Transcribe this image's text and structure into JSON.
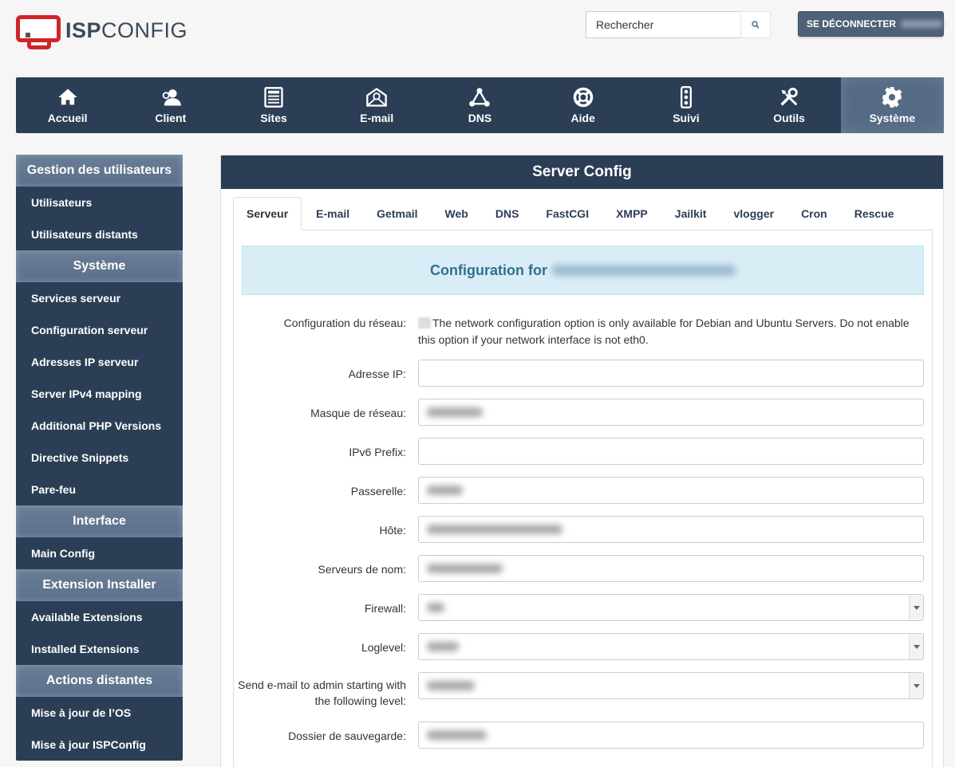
{
  "brand": {
    "logo_bold": "ISP",
    "logo_rest": "CONFIG",
    "accent": "#d2232a"
  },
  "search": {
    "placeholder": "Rechercher",
    "icon": "search-icon"
  },
  "logout": {
    "label": "SE DÉCONNECTER"
  },
  "topnav": [
    {
      "label": "Accueil",
      "icon": "home-icon"
    },
    {
      "label": "Client",
      "icon": "users-icon"
    },
    {
      "label": "Sites",
      "icon": "sites-icon"
    },
    {
      "label": "E-mail",
      "icon": "mail-icon"
    },
    {
      "label": "DNS",
      "icon": "dns-icon"
    },
    {
      "label": "Aide",
      "icon": "lifebuoy-icon"
    },
    {
      "label": "Suivi",
      "icon": "traffic-light-icon"
    },
    {
      "label": "Outils",
      "icon": "tools-icon"
    },
    {
      "label": "Système",
      "icon": "gear-icon",
      "active": true
    }
  ],
  "sidebar": {
    "sections": [
      {
        "heading": "Gestion des utilisateurs",
        "items": [
          "Utilisateurs",
          "Utilisateurs distants"
        ]
      },
      {
        "heading": "Système",
        "items": [
          "Services serveur",
          "Configuration serveur",
          "Adresses IP serveur",
          "Server IPv4 mapping",
          "Additional PHP Versions",
          "Directive Snippets",
          "Pare-feu"
        ]
      },
      {
        "heading": "Interface",
        "items": [
          "Main Config"
        ]
      },
      {
        "heading": "Extension Installer",
        "items": [
          "Available Extensions",
          "Installed Extensions"
        ]
      },
      {
        "heading": "Actions distantes",
        "items": [
          "Mise à jour de l’OS",
          "Mise à jour ISPConfig"
        ]
      }
    ]
  },
  "panel": {
    "title": "Server Config",
    "tabs": [
      "Serveur",
      "E-mail",
      "Getmail",
      "Web",
      "DNS",
      "FastCGI",
      "XMPP",
      "Jailkit",
      "vlogger",
      "Cron",
      "Rescue"
    ],
    "active_tab": "Serveur",
    "banner": "Configuration for",
    "network_label": "Configuration du réseau:",
    "network_text": "The network configuration option is only available for Debian and Ubuntu Servers. Do not enable this option if your network interface is not eth0.",
    "fields": [
      {
        "label": "Adresse IP:",
        "type": "text",
        "value": ""
      },
      {
        "label": "Masque de réseau:",
        "type": "text",
        "value": ""
      },
      {
        "label": "IPv6 Prefix:",
        "type": "text",
        "value": ""
      },
      {
        "label": "Passerelle:",
        "type": "text",
        "value": ""
      },
      {
        "label": "Hôte:",
        "type": "text",
        "value": ""
      },
      {
        "label": "Serveurs de nom:",
        "type": "text",
        "value": ""
      },
      {
        "label": "Firewall:",
        "type": "select",
        "value": ""
      },
      {
        "label": "Loglevel:",
        "type": "select",
        "value": ""
      },
      {
        "label": "Send e-mail to admin starting with the following level:",
        "type": "select",
        "value": ""
      },
      {
        "label": "Dossier de sauvegarde:",
        "type": "text",
        "value": ""
      }
    ]
  }
}
